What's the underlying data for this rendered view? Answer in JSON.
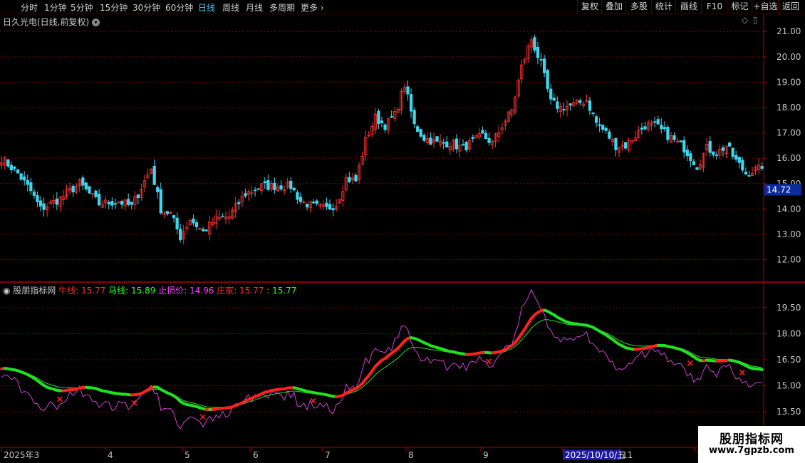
{
  "toolbar": {
    "periods": [
      "分时",
      "1分钟",
      "5分钟",
      "15分钟",
      "30分钟",
      "60分钟",
      "日线",
      "周线",
      "月线",
      "多周期",
      "更多"
    ],
    "active_period": "日线",
    "buttons": [
      "复权",
      "叠加",
      "多股",
      "统计",
      "画线",
      "F10",
      "标记",
      "+自选",
      "返回"
    ]
  },
  "stock": {
    "title": "日久光电(日线,前复权)",
    "current_price_label": "14.72"
  },
  "indicator": {
    "name": "股朋指标网",
    "items": [
      {
        "label": "牛线: 15.77",
        "color": "#ff3030"
      },
      {
        "label": "马线: 15.89",
        "color": "#30ff30"
      },
      {
        "label": "止损价: 14.96",
        "color": "#ff40ff"
      },
      {
        "label": "庄家: 15.77",
        "color": "#ff3030"
      },
      {
        "label": ": 15.77",
        "color": "#30ff30"
      }
    ]
  },
  "date_axis": {
    "labels": [
      "2025年3",
      "4",
      "5",
      "6",
      "7",
      "8",
      "9",
      "2025/10/10/五",
      "11",
      "1"
    ],
    "highlight": "2025/10/10/五"
  },
  "watermark": {
    "line1": "股朋指标网",
    "line2": "www.7gpzb.com"
  },
  "colors": {
    "up": "#ff3333",
    "down": "#3ed6ee",
    "grid": "#7a0000",
    "axis": "#b00000",
    "bull": "#ff2020",
    "horse": "#22e022",
    "stop": "#d040d0",
    "price_box": "#0a2aa0"
  },
  "chart_data": [
    {
      "type": "candlestick",
      "title": "日久光电(日线,前复权)",
      "ylim": [
        11.2,
        21.4
      ],
      "y_ticks": [
        "12.00",
        "13.00",
        "14.00",
        "15.00",
        "16.00",
        "17.00",
        "18.00",
        "19.00",
        "20.00",
        "21.00"
      ],
      "x": [
        "2025-03",
        "2025-04",
        "2025-05",
        "2025-06",
        "2025-07",
        "2025-08",
        "2025-09",
        "2025-10",
        "2025-11",
        "2025-12"
      ],
      "close_anchors": [
        [
          0,
          16.0
        ],
        [
          5,
          15.4
        ],
        [
          9,
          14.7
        ],
        [
          12,
          14.0
        ],
        [
          18,
          14.4
        ],
        [
          24,
          15.0
        ],
        [
          30,
          14.2
        ],
        [
          36,
          14.3
        ],
        [
          40,
          14.1
        ],
        [
          46,
          15.6
        ],
        [
          49,
          14.0
        ],
        [
          52,
          13.8
        ],
        [
          55,
          12.9
        ],
        [
          58,
          13.6
        ],
        [
          62,
          13.1
        ],
        [
          66,
          13.6
        ],
        [
          70,
          13.7
        ],
        [
          75,
          14.6
        ],
        [
          80,
          14.9
        ],
        [
          85,
          14.9
        ],
        [
          89,
          14.9
        ],
        [
          92,
          14.3
        ],
        [
          96,
          14.1
        ],
        [
          100,
          14.0
        ],
        [
          103,
          14.2
        ],
        [
          106,
          15.2
        ],
        [
          109,
          15.1
        ],
        [
          112,
          16.7
        ],
        [
          115,
          17.6
        ],
        [
          118,
          17.3
        ],
        [
          121,
          17.7
        ],
        [
          124,
          18.9
        ],
        [
          127,
          17.3
        ],
        [
          130,
          16.8
        ],
        [
          134,
          16.6
        ],
        [
          138,
          16.6
        ],
        [
          142,
          16.4
        ],
        [
          148,
          16.9
        ],
        [
          151,
          16.6
        ],
        [
          154,
          17.3
        ],
        [
          157,
          17.9
        ],
        [
          160,
          19.6
        ],
        [
          163,
          20.7
        ],
        [
          166,
          19.7
        ],
        [
          169,
          18.2
        ],
        [
          172,
          18.0
        ],
        [
          176,
          18.1
        ],
        [
          180,
          18.3
        ],
        [
          183,
          17.4
        ],
        [
          186,
          17.0
        ],
        [
          189,
          16.5
        ],
        [
          192,
          16.5
        ],
        [
          195,
          16.9
        ],
        [
          198,
          17.3
        ],
        [
          201,
          17.3
        ],
        [
          204,
          17.0
        ],
        [
          207,
          16.7
        ],
        [
          210,
          16.4
        ],
        [
          214,
          15.7
        ],
        [
          217,
          16.4
        ],
        [
          220,
          16.2
        ],
        [
          223,
          16.5
        ],
        [
          226,
          15.9
        ],
        [
          229,
          15.4
        ],
        [
          232,
          15.55
        ],
        [
          234,
          15.6
        ]
      ],
      "last_close": 15.6
    },
    {
      "type": "line",
      "title": "股朋指标网",
      "ylim": [
        12.6,
        20.4
      ],
      "y_ticks": [
        "13.50",
        "15.00",
        "16.50",
        "18.00",
        "19.50"
      ],
      "series": [
        {
          "name": "牛线",
          "color": "#ff2020",
          "value": 15.77
        },
        {
          "name": "马线",
          "color": "#22e022",
          "value": 15.89
        },
        {
          "name": "止损价",
          "color": "#d040d0",
          "value": 14.96
        },
        {
          "name": "庄家",
          "color": "#ff2020",
          "value": 15.77
        }
      ]
    }
  ]
}
